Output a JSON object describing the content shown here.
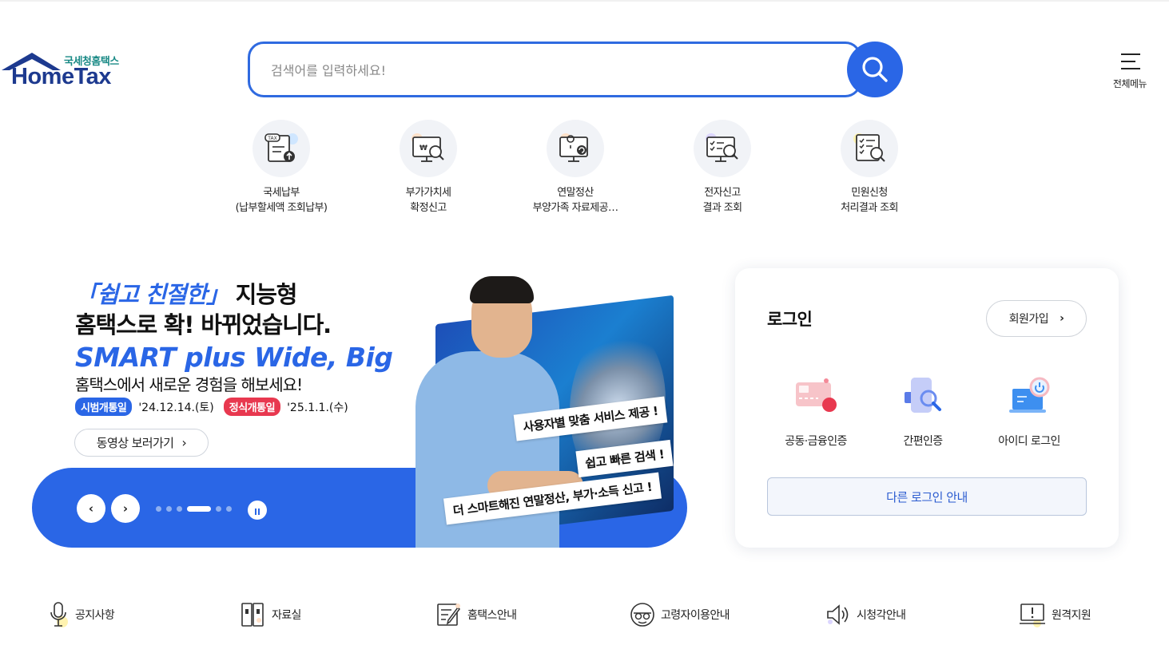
{
  "header": {
    "logo_sub": "국세청홈택스",
    "logo_main": "HomeTax",
    "search_placeholder": "검색어를 입력하세요!",
    "all_menu_label": "전체메뉴"
  },
  "quick_menu": [
    {
      "line1": "국세납부",
      "line2": "(납부할세액 조회납부)",
      "icon": "tax-payment-icon"
    },
    {
      "line1": "부가가치세",
      "line2": "확정신고",
      "icon": "vat-report-icon"
    },
    {
      "line1": "연말정산",
      "line2": "부양가족 자료제공…",
      "icon": "year-end-settlement-icon"
    },
    {
      "line1": "전자신고",
      "line2": "결과 조회",
      "icon": "e-filing-result-icon"
    },
    {
      "line1": "민원신청",
      "line2": "처리결과 조회",
      "icon": "civil-request-result-icon"
    }
  ],
  "banner": {
    "headline_quote": "「쉽고 친절한」",
    "headline_rest": " 지능형",
    "headline_line2": "홈택스로 확! 바뀌었습니다.",
    "headline_line3": "SMART plus Wide, Big",
    "subtext": "홈택스에서 새로운 경험을 해보세요!",
    "pilot_label": "시범개통일",
    "pilot_date": "'24.12.14.(토)",
    "official_label": "정식개통일",
    "official_date": "'25.1.1.(수)",
    "video_button": "동영상 보러가기",
    "tags": [
      "사용자별 맞춤 서비스 제공 !",
      "쉽고 빠른 검색 !",
      "더 스마트해진 연말정산, 부가·소득 신고 !"
    ],
    "slide_count": 6,
    "active_slide": 4
  },
  "login": {
    "title": "로그인",
    "join_button": "회원가입",
    "options": [
      {
        "label": "공동·금융인증",
        "icon": "certificate-icon"
      },
      {
        "label": "간편인증",
        "icon": "simple-auth-icon"
      },
      {
        "label": "아이디 로그인",
        "icon": "id-login-icon"
      }
    ],
    "other_login": "다른 로그인 안내"
  },
  "bottom_links": [
    {
      "label": "공지사항",
      "icon": "microphone-icon"
    },
    {
      "label": "자료실",
      "icon": "archive-icon"
    },
    {
      "label": "홈택스안내",
      "icon": "guide-icon"
    },
    {
      "label": "고령자이용안내",
      "icon": "senior-icon"
    },
    {
      "label": "시청각안내",
      "icon": "speaker-icon"
    },
    {
      "label": "원격지원",
      "icon": "remote-support-icon"
    }
  ],
  "colors": {
    "primary": "#2a66e6",
    "logo_navy": "#1d3a8f",
    "logo_teal": "#1a8a86",
    "official_red": "#e8384f"
  }
}
